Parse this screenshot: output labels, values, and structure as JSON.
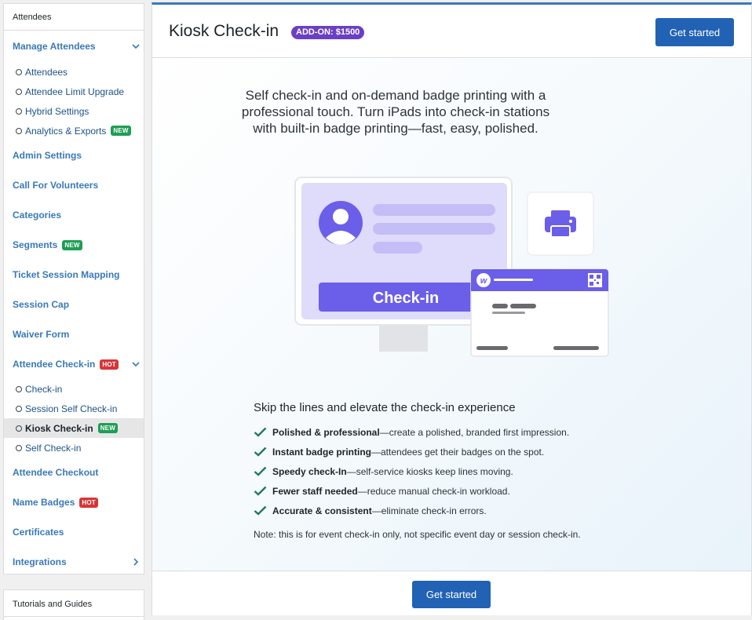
{
  "sidebar": {
    "header": "Attendees",
    "items": [
      {
        "label": "Manage Attendees",
        "type": "top",
        "expanded": true
      },
      {
        "label": "Attendees",
        "type": "sub"
      },
      {
        "label": "Attendee Limit Upgrade",
        "type": "sub"
      },
      {
        "label": "Hybrid Settings",
        "type": "sub"
      },
      {
        "label": "Analytics & Exports",
        "type": "sub",
        "badge": "NEW"
      },
      {
        "label": "Admin Settings",
        "type": "top"
      },
      {
        "label": "Call For Volunteers",
        "type": "top"
      },
      {
        "label": "Categories",
        "type": "top"
      },
      {
        "label": "Segments",
        "type": "top",
        "badge": "NEW"
      },
      {
        "label": "Ticket Session Mapping",
        "type": "top"
      },
      {
        "label": "Session Cap",
        "type": "top"
      },
      {
        "label": "Waiver Form",
        "type": "top"
      },
      {
        "label": "Attendee Check-in",
        "type": "top",
        "badge": "HOT",
        "expanded": true
      },
      {
        "label": "Check-in",
        "type": "sub"
      },
      {
        "label": "Session Self Check-in",
        "type": "sub"
      },
      {
        "label": "Kiosk Check-in",
        "type": "sub",
        "badge": "NEW",
        "active": true
      },
      {
        "label": "Self Check-in",
        "type": "sub"
      },
      {
        "label": "Attendee Checkout",
        "type": "top"
      },
      {
        "label": "Name Badges",
        "type": "top",
        "badge": "HOT"
      },
      {
        "label": "Certificates",
        "type": "top"
      },
      {
        "label": "Integrations",
        "type": "top",
        "collapsed": true
      }
    ],
    "tutorials_header": "Tutorials and Guides"
  },
  "main": {
    "title": "Kiosk Check-in",
    "addon_badge": "ADD-ON: $1500",
    "cta_top": "Get started",
    "intro": "Self check-in and on-demand badge printing with a professional touch. Turn iPads into check-in stations with built-in badge printing—fast, easy, polished.",
    "illustration": {
      "checkin_label": "Check-in",
      "badge_logo": "w",
      "printer_icon": "printer-icon",
      "avatar_icon": "user-avatar-icon",
      "qr_icon": "qr-code-icon"
    },
    "benefits_title": "Skip the lines and elevate the check-in experience",
    "benefits": [
      {
        "bold": "Polished & professional",
        "text": "—create a polished, branded first impression."
      },
      {
        "bold": "Instant badge printing",
        "text": "—attendees get their badges on the spot."
      },
      {
        "bold": "Speedy check-In",
        "text": "—self-service kiosks keep lines moving."
      },
      {
        "bold": "Fewer staff needed",
        "text": "—reduce manual check-in workload."
      },
      {
        "bold": "Accurate & consistent",
        "text": "—eliminate check-in errors."
      }
    ],
    "note": "Note: this is for event check-in only, not specific event day or session check-in.",
    "cta_bottom": "Get started"
  },
  "colors": {
    "link": "#3a79b8",
    "primary_button": "#2162b5",
    "addon": "#6b3fc4",
    "badge_new": "#1e9e55",
    "badge_hot": "#d63638",
    "illustration_purple": "#6b5ee8",
    "check_green": "#1f7a5c"
  }
}
